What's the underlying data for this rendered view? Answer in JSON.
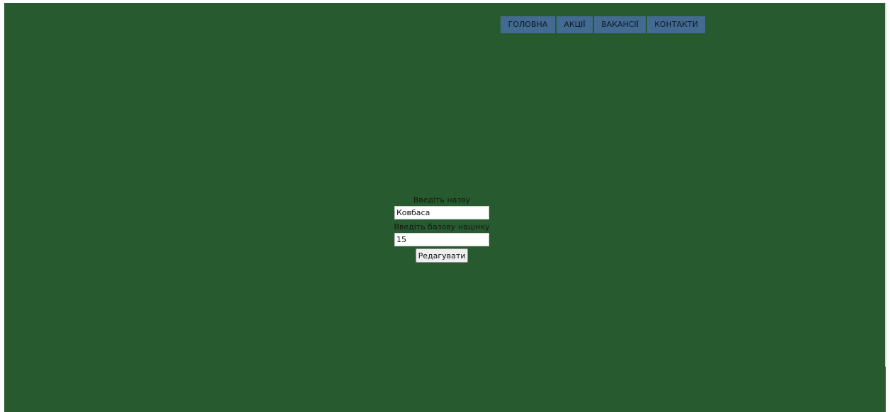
{
  "nav": {
    "items": [
      {
        "label": "ГОЛОВНА"
      },
      {
        "label": "АКЦІЇ"
      },
      {
        "label": "ВАКАНСІЇ"
      },
      {
        "label": "КОНТАКТИ"
      }
    ]
  },
  "form": {
    "name_label": "Введіть назву",
    "name_value": "Ковбаса",
    "markup_label": "Введіть базову націнку",
    "markup_value": "15",
    "submit_label": "Редагувати"
  },
  "colors": {
    "background": "#275a2f",
    "nav_button": "#436b91"
  }
}
